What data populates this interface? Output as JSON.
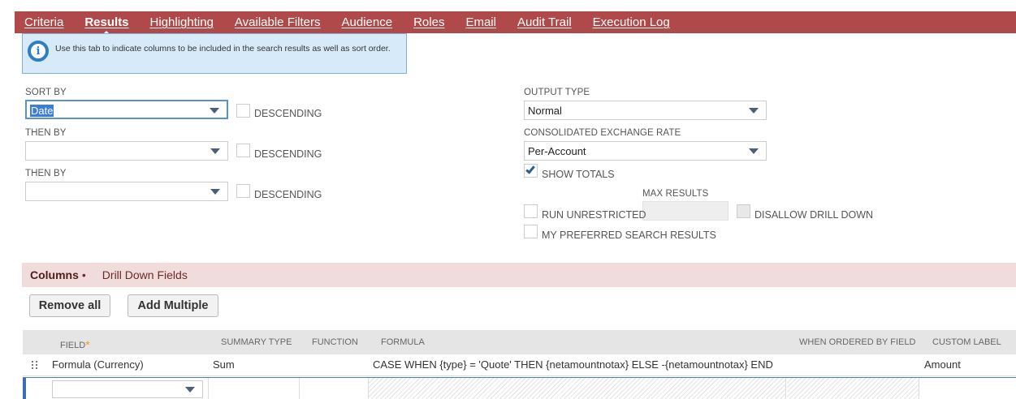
{
  "tabs": [
    {
      "label": "Criteria",
      "active": false
    },
    {
      "label": "Results",
      "active": true
    },
    {
      "label": "Highlighting",
      "active": false
    },
    {
      "label": "Available Filters",
      "active": false
    },
    {
      "label": "Audience",
      "active": false
    },
    {
      "label": "Roles",
      "active": false
    },
    {
      "label": "Email",
      "active": false
    },
    {
      "label": "Audit Trail",
      "active": false
    },
    {
      "label": "Execution Log",
      "active": false
    }
  ],
  "info": {
    "text": "Use this tab to indicate columns to be included in the search results as well as sort order.",
    "icon": "info-icon"
  },
  "sort": {
    "sort_by_label": "SORT BY",
    "sort_by_value": "Date",
    "then_by_label": "THEN BY",
    "then_by_value_1": "",
    "then_by_value_2": "",
    "descending_label": "DESCENDING"
  },
  "output": {
    "output_type_label": "OUTPUT TYPE",
    "output_type_value": "Normal",
    "exchange_rate_label": "CONSOLIDATED EXCHANGE RATE",
    "exchange_rate_value": "Per-Account",
    "show_totals_label": "SHOW TOTALS",
    "show_totals_checked": true,
    "max_results_label": "MAX RESULTS",
    "max_results_value": "",
    "run_unrestricted_label": "RUN UNRESTRICTED",
    "disallow_drill_down_label": "DISALLOW DRILL DOWN",
    "preferred_label": "MY PREFERRED SEARCH RESULTS"
  },
  "subtabs": {
    "columns_label": "Columns",
    "drill_down_label": "Drill Down Fields"
  },
  "buttons": {
    "remove_all": "Remove all",
    "add_multiple": "Add Multiple"
  },
  "table": {
    "headers": {
      "field": "FIELD",
      "summary_type": "SUMMARY TYPE",
      "function": "FUNCTION",
      "formula": "FORMULA",
      "when_ordered": "WHEN ORDERED BY FIELD",
      "custom_label": "CUSTOM LABEL"
    },
    "rows": [
      {
        "field": "Formula (Currency)",
        "summary_type": "Sum",
        "function": "",
        "formula": "CASE WHEN {type} = 'Quote' THEN {netamountnotax} ELSE -{netamountnotax} END",
        "when_ordered": "",
        "custom_label": "Amount"
      }
    ]
  },
  "colors": {
    "tab_bar": "#b04a4a",
    "subtab_bar": "#f1dcdc",
    "info_bg": "#d7eafa",
    "required_star": "#f29a1f"
  }
}
